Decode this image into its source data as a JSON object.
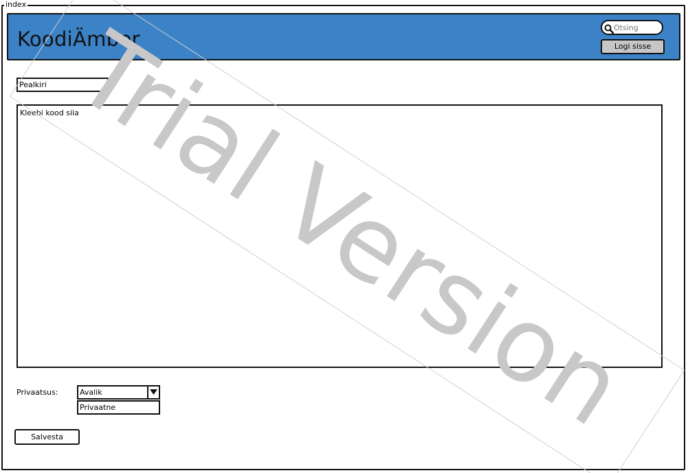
{
  "window": {
    "title": "index"
  },
  "header": {
    "logo": "KoodiÄmber",
    "search": {
      "placeholder": "Otsing",
      "value": ""
    },
    "login_label": "Logi sisse",
    "background_color": "#3c82c6"
  },
  "form": {
    "title_field": {
      "placeholder": "Pealkiri"
    },
    "code_area": {
      "placeholder": "Kleebi kood siia"
    },
    "privacy": {
      "label": "Privaatsus:",
      "selected": "Avalik",
      "options": [
        "Privaatne"
      ]
    },
    "save_label": "Salvesta"
  },
  "watermark": {
    "text": "Trial Version"
  }
}
